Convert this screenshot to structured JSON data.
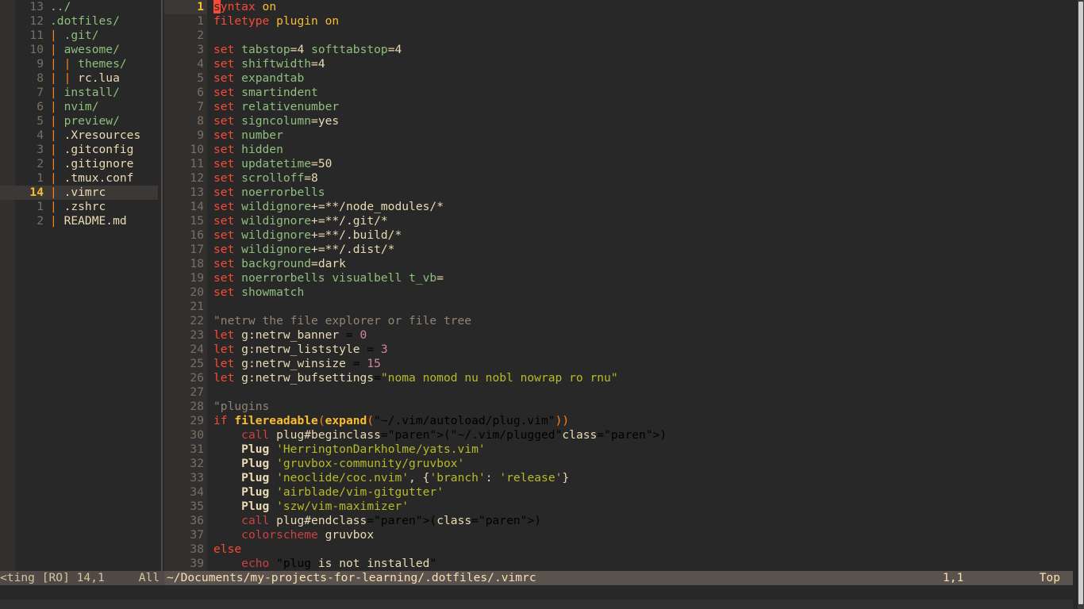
{
  "app": {
    "name": "vim",
    "colorscheme": "gruvbox"
  },
  "colors": {
    "background": "#282828",
    "cursorline": "#3c3836",
    "signcolumn": "#32302f",
    "linenr": "#7c6f64",
    "cursor_linenr": "#fabd2f",
    "keyword_red": "#fb4934",
    "option_green": "#8ec07c",
    "string_green": "#b8bb26",
    "number_purple": "#d3869b",
    "function_yellow": "#fabd2f",
    "paren_orange": "#fe8019",
    "comment_gray": "#928374",
    "foreground": "#ebdbb2",
    "statusline_bg": "#504945",
    "statusline_active_bg": "#5a524c",
    "tree_marker_orange": "#fe8019",
    "scrollbar_thumb": "#cfcfcf"
  },
  "netrw": {
    "name": "netrw-file-explorer",
    "cursor_row_index": 12,
    "rows": [
      {
        "num": "13",
        "tree": "",
        "name": "../",
        "kind": "updir"
      },
      {
        "num": "12",
        "tree": "",
        "name": ".dotfiles/",
        "kind": "dir"
      },
      {
        "num": "11",
        "tree": "|",
        "name": ".git/",
        "kind": "dir"
      },
      {
        "num": "10",
        "tree": "|",
        "name": "awesome/",
        "kind": "dir"
      },
      {
        "num": "9",
        "tree": "| |",
        "name": "themes/",
        "kind": "dir"
      },
      {
        "num": "8",
        "tree": "| |",
        "name": "rc.lua",
        "kind": "file"
      },
      {
        "num": "7",
        "tree": "|",
        "name": "install/",
        "kind": "dir"
      },
      {
        "num": "6",
        "tree": "|",
        "name": "nvim/",
        "kind": "dir"
      },
      {
        "num": "5",
        "tree": "|",
        "name": "preview/",
        "kind": "dir"
      },
      {
        "num": "4",
        "tree": "|",
        "name": ".Xresources",
        "kind": "file"
      },
      {
        "num": "3",
        "tree": "|",
        "name": ".gitconfig",
        "kind": "file"
      },
      {
        "num": "2",
        "tree": "|",
        "name": ".gitignore",
        "kind": "file"
      },
      {
        "num": "1",
        "tree": "|",
        "name": ".tmux.conf",
        "kind": "file"
      },
      {
        "num": "14",
        "tree": "|",
        "name": ".vimrc",
        "kind": "file"
      },
      {
        "num": "1",
        "tree": "|",
        "name": ".zshrc",
        "kind": "file"
      },
      {
        "num": "2",
        "tree": "|",
        "name": "README.md",
        "kind": "file"
      }
    ],
    "empty_line_marker": "~",
    "empty_line_count": 24
  },
  "editor": {
    "name": "vimrc-buffer",
    "cursor_line": 1,
    "cursor_char": "s",
    "lines": [
      {
        "num": "1",
        "relnum": "1",
        "current": true
      },
      {
        "num": "1",
        "current": false
      },
      {
        "num": "2",
        "current": false
      },
      {
        "num": "3",
        "current": false
      },
      {
        "num": "4",
        "current": false
      },
      {
        "num": "5",
        "current": false
      },
      {
        "num": "6",
        "current": false
      },
      {
        "num": "7",
        "current": false
      },
      {
        "num": "8",
        "current": false
      },
      {
        "num": "9",
        "current": false
      },
      {
        "num": "10",
        "current": false
      },
      {
        "num": "11",
        "current": false
      },
      {
        "num": "12",
        "current": false
      },
      {
        "num": "13",
        "current": false
      },
      {
        "num": "14",
        "current": false
      },
      {
        "num": "15",
        "current": false
      },
      {
        "num": "16",
        "current": false
      },
      {
        "num": "17",
        "current": false
      },
      {
        "num": "18",
        "current": false
      },
      {
        "num": "19",
        "current": false
      },
      {
        "num": "20",
        "current": false
      },
      {
        "num": "21",
        "current": false
      },
      {
        "num": "22",
        "current": false
      },
      {
        "num": "23",
        "current": false
      },
      {
        "num": "24",
        "current": false
      },
      {
        "num": "25",
        "current": false
      },
      {
        "num": "26",
        "current": false
      },
      {
        "num": "27",
        "current": false
      },
      {
        "num": "28",
        "current": false
      },
      {
        "num": "29",
        "current": false
      },
      {
        "num": "30",
        "current": false
      },
      {
        "num": "31",
        "current": false
      },
      {
        "num": "32",
        "current": false
      },
      {
        "num": "33",
        "current": false
      },
      {
        "num": "34",
        "current": false
      },
      {
        "num": "35",
        "current": false
      },
      {
        "num": "36",
        "current": false
      },
      {
        "num": "37",
        "current": false
      },
      {
        "num": "38",
        "current": false
      },
      {
        "num": "39",
        "current": false
      }
    ],
    "source_text": [
      "syntax on",
      "filetype plugin on",
      "",
      "set tabstop=4 softtabstop=4",
      "set shiftwidth=4",
      "set expandtab",
      "set smartindent",
      "set relativenumber",
      "set signcolumn=yes",
      "set number",
      "set hidden",
      "set updatetime=50",
      "set scrolloff=8",
      "set noerrorbells",
      "set wildignore+=**/node_modules/*",
      "set wildignore+=**/.git/*",
      "set wildignore+=**/.build/*",
      "set wildignore+=**/.dist/*",
      "set background=dark",
      "set noerrorbells visualbell t_vb=",
      "set showmatch",
      "",
      "\"netrw the file explorer or file tree",
      "let g:netrw_banner = 0",
      "let g:netrw_liststyle = 3",
      "let g:netrw_winsize = 15",
      "let g:netrw_bufsettings=\"noma nomod nu nobl nowrap ro rnu\"",
      "",
      "\"plugins",
      "if filereadable(expand(\"~/.vim/autoload/plug.vim\"))",
      "    call plug#begin(\"~/.vim/plugged\")",
      "    Plug 'HerringtonDarkholme/yats.vim'",
      "    Plug 'gruvbox-community/gruvbox'",
      "    Plug 'neoclide/coc.nvim', {'branch': 'release'}",
      "    Plug 'airblade/vim-gitgutter'",
      "    Plug 'szw/vim-maximizer'",
      "    call plug#end()",
      "    colorscheme gruvbox",
      "else",
      "    echo \"plug is not installed\""
    ]
  },
  "statusline": {
    "netrw_status": "<ting [RO] 14,1",
    "netrw_scroll": "All",
    "file_path": "~/Documents/my-projects-for-learning/.dotfiles/.vimrc",
    "cursor_position": "1,1",
    "scroll_percent": "Top"
  },
  "commandline": {
    "text": ""
  }
}
